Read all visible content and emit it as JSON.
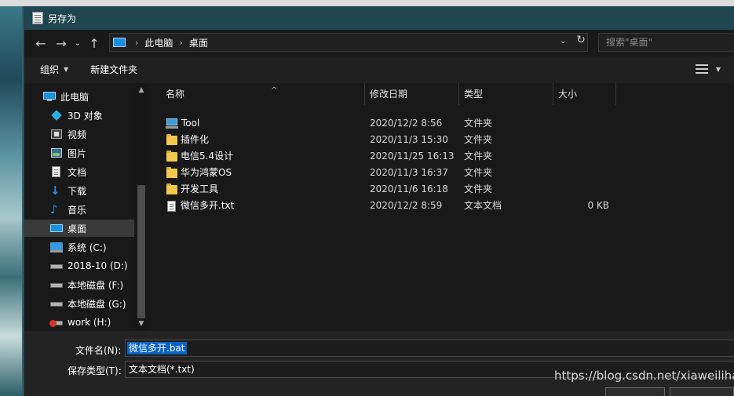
{
  "dialog": {
    "title": "另存为"
  },
  "address": {
    "crumbs": [
      "此电脑",
      "桌面"
    ],
    "search_placeholder": "搜索\"桌面\""
  },
  "toolbar": {
    "organize": "组织",
    "new_folder": "新建文件夹"
  },
  "nav": [
    {
      "label": "此电脑",
      "icon": "monitor-icon"
    },
    {
      "label": "3D 对象",
      "icon": "cube-icon"
    },
    {
      "label": "视频",
      "icon": "video-icon"
    },
    {
      "label": "图片",
      "icon": "picture-icon"
    },
    {
      "label": "文档",
      "icon": "document-icon"
    },
    {
      "label": "下载",
      "icon": "download-arrow-icon"
    },
    {
      "label": "音乐",
      "icon": "music-note-icon"
    },
    {
      "label": "桌面",
      "icon": "desktop-icon",
      "selected": true
    },
    {
      "label": "系统 (C:)",
      "icon": "drive-icon"
    },
    {
      "label": "2018-10 (D:)",
      "icon": "drive-icon"
    },
    {
      "label": "本地磁盘 (F:)",
      "icon": "drive-icon"
    },
    {
      "label": "本地磁盘 (G:)",
      "icon": "drive-icon"
    },
    {
      "label": "work (H:)",
      "icon": "network-drive-icon"
    }
  ],
  "columns": {
    "name": "名称",
    "date": "修改日期",
    "type": "类型",
    "size": "大小"
  },
  "files": [
    {
      "name": "Tool",
      "date": "2020/12/2 8:56",
      "type": "文件夹",
      "size": "",
      "icon": "network-folder-icon"
    },
    {
      "name": "插件化",
      "date": "2020/11/3 15:30",
      "type": "文件夹",
      "size": "",
      "icon": "folder-icon"
    },
    {
      "name": "电信5.4设计",
      "date": "2020/11/25 16:13",
      "type": "文件夹",
      "size": "",
      "icon": "folder-icon"
    },
    {
      "name": "华为鸿蒙OS",
      "date": "2020/11/3 16:37",
      "type": "文件夹",
      "size": "",
      "icon": "folder-icon"
    },
    {
      "name": "开发工具",
      "date": "2020/11/6 16:18",
      "type": "文件夹",
      "size": "",
      "icon": "folder-icon"
    },
    {
      "name": "微信多开.txt",
      "date": "2020/12/2 8:59",
      "type": "文本文档",
      "size": "0 KB",
      "icon": "text-file-icon"
    }
  ],
  "save": {
    "filename_label": "文件名(N):",
    "filename_value": "微信多开.bat",
    "filetype_label": "保存类型(T):",
    "filetype_value": "文本文档(*.txt)"
  },
  "watermark": "https://blog.csdn.net/xiaweilihai"
}
